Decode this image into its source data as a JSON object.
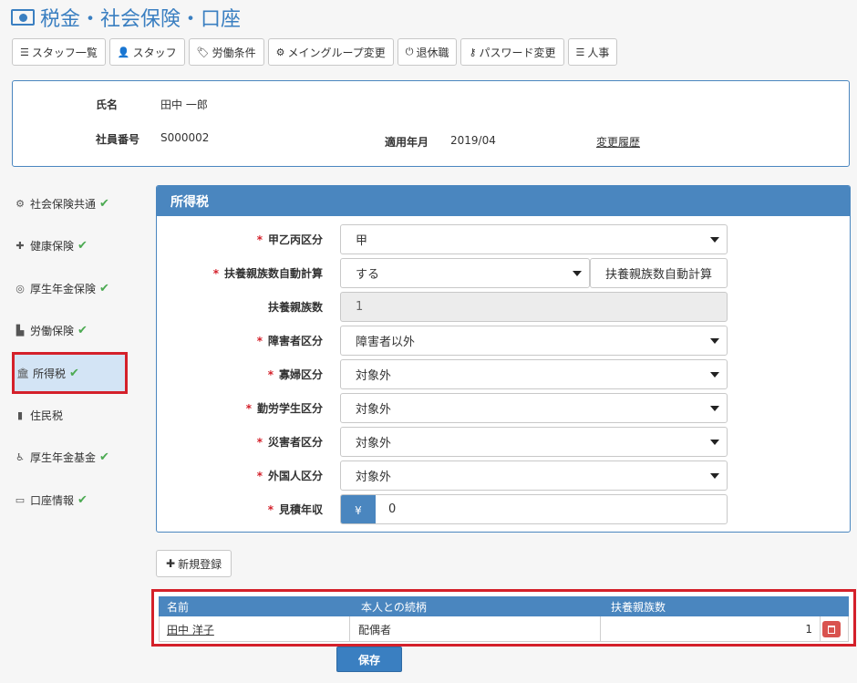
{
  "page": {
    "title": "税金・社会保険・口座"
  },
  "toolbar": {
    "buttons": [
      {
        "label": "スタッフ一覧",
        "icon": "list-icon"
      },
      {
        "label": "スタッフ",
        "icon": "user-icon"
      },
      {
        "label": "労働条件",
        "icon": "tag-icon"
      },
      {
        "label": "メイングループ変更",
        "icon": "gears-icon"
      },
      {
        "label": "退休職",
        "icon": "power-icon"
      },
      {
        "label": "パスワード変更",
        "icon": "key-icon"
      },
      {
        "label": "人事",
        "icon": "list-icon"
      }
    ]
  },
  "info": {
    "name_label": "氏名",
    "name_value": "田中 一郎",
    "id_label": "社員番号",
    "id_value": "S000002",
    "date_label": "適用年月",
    "date_value": "2019/04",
    "history_link": "変更履歴"
  },
  "sidebar": {
    "items": [
      {
        "label": "社会保険共通",
        "icon": "gear-icon",
        "check": "✔"
      },
      {
        "label": "健康保険",
        "icon": "medkit-icon",
        "check": "✔"
      },
      {
        "label": "厚生年金保険",
        "icon": "lifebuoy-icon",
        "check": "✔"
      },
      {
        "label": "労働保険",
        "icon": "factory-icon",
        "check": "✔"
      },
      {
        "label": "所得税",
        "icon": "bank-icon",
        "check": "✔"
      },
      {
        "label": "住民税",
        "icon": "building-icon",
        "check": ""
      },
      {
        "label": "厚生年金基金",
        "icon": "wheelchair-icon",
        "check": "✔"
      },
      {
        "label": "口座情報",
        "icon": "credit-card-icon",
        "check": "✔"
      }
    ]
  },
  "panel": {
    "title": "所得税",
    "required_mark": "*",
    "fields": {
      "kou_otsu": {
        "label": "甲乙丙区分",
        "value": "甲"
      },
      "auto_calc": {
        "label": "扶養親族数自動計算",
        "value": "する",
        "button": "扶養親族数自動計算"
      },
      "dependents": {
        "label": "扶養親族数",
        "value": "1"
      },
      "disability": {
        "label": "障害者区分",
        "value": "障害者以外"
      },
      "widow": {
        "label": "寡婦区分",
        "value": "対象外"
      },
      "student": {
        "label": "勤労学生区分",
        "value": "対象外"
      },
      "disaster": {
        "label": "災害者区分",
        "value": "対象外"
      },
      "foreigner": {
        "label": "外国人区分",
        "value": "対象外"
      },
      "income": {
        "label": "見積年収",
        "prefix": "¥",
        "value": "0"
      }
    }
  },
  "new_button": "新規登録",
  "table": {
    "headers": [
      "名前",
      "本人との続柄",
      "扶養親族数"
    ],
    "rows": [
      {
        "name": "田中 洋子",
        "relation": "配偶者",
        "count": "1"
      }
    ]
  },
  "save_button": "保存",
  "colors": {
    "accent": "#4a86bf",
    "required": "#d4202a",
    "check": "#4caa52",
    "danger": "#d9534f"
  }
}
